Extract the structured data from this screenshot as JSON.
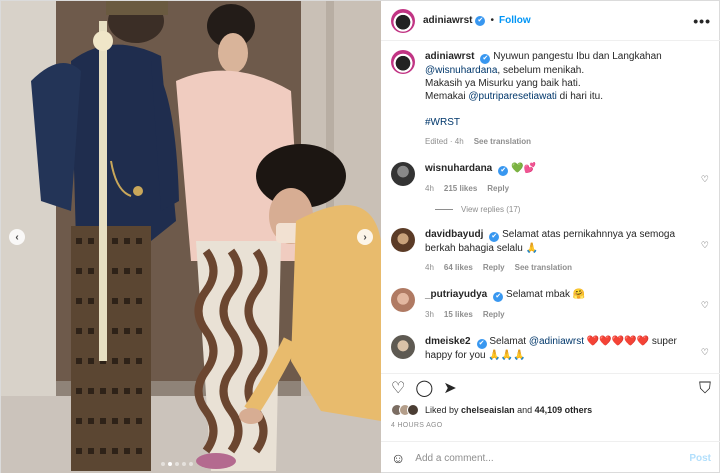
{
  "post": {
    "username": "adiniawrst",
    "verified_mark": "✔",
    "separator": "•",
    "follow_label": "Follow",
    "more_icon": "•••"
  },
  "caption": {
    "username": "adiniawrst",
    "line1": "Nyuwun pangestu Ibu dan Langkahan",
    "mention1": "@wisnuhardana",
    "line2_rest": ", sebelum menikah.",
    "line3": "Makasih ya Misurku yang baik hati.",
    "line4_pre": "Memakai",
    "mention2": "@putriparesetiawati",
    "line4_post": "di hari itu.",
    "hashtag": "#WRST",
    "edited": "Edited · 4h",
    "see_translation": "See translation"
  },
  "comments": [
    {
      "username": "wisnuhardana",
      "text": "💚💕",
      "time": "4h",
      "likes": "215 likes",
      "reply": "Reply"
    },
    {
      "username": "davidbayudj",
      "text": "Selamat atas pernikahnnya ya semoga berkah bahagia selalu 🙏",
      "time": "4h",
      "likes": "64 likes",
      "reply": "Reply",
      "see_translation": "See translation"
    },
    {
      "username": "_putriayudya",
      "text": "Selamat mbak 🤗",
      "time": "3h",
      "likes": "15 likes",
      "reply": "Reply"
    },
    {
      "username": "dmeiske2",
      "text_pre": "Selamat",
      "mention": "@adiniawrst",
      "hearts": "❤️❤️❤️❤️❤️",
      "text_post": "super happy for you 🙏🙏🙏"
    }
  ],
  "view_replies": "View replies (17)",
  "actions": {
    "like_icon": "♡",
    "comment_icon": "◯",
    "share_icon": "➤",
    "bookmark_icon": "⛉"
  },
  "likes": {
    "prefix": "Liked by",
    "user": "chelseaislan",
    "and": "and",
    "count": "44,109 others"
  },
  "time_ago": "4 HOURS AGO",
  "add_comment": {
    "emoji_icon": "☺",
    "placeholder": "Add a comment...",
    "post_label": "Post"
  },
  "carousel": {
    "prev_icon": "‹",
    "next_icon": "›"
  },
  "colors": {
    "accent": "#0095f6",
    "verified": "#3897f0",
    "link": "#00376b",
    "muted": "#8e8e8e"
  }
}
